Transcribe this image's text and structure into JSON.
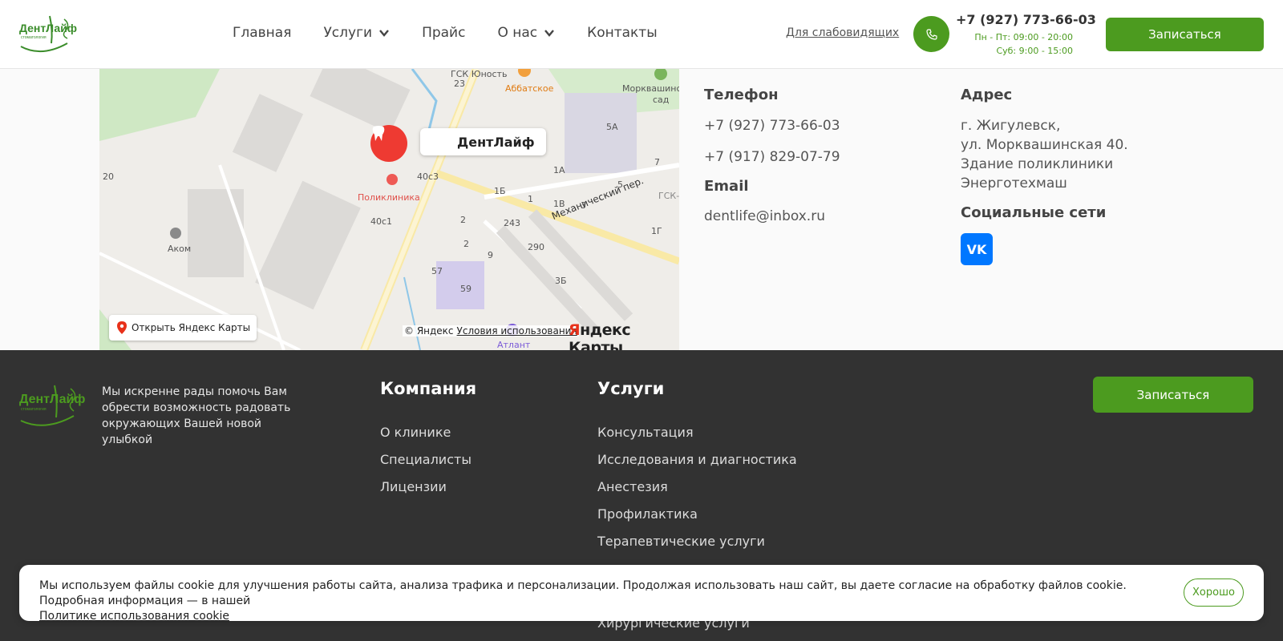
{
  "header": {
    "logo_text": "ДентЛайф",
    "nav": [
      {
        "label": "Главная",
        "dropdown": false
      },
      {
        "label": "Услуги",
        "dropdown": true
      },
      {
        "label": "Прайс",
        "dropdown": false
      },
      {
        "label": "О нас",
        "dropdown": true
      },
      {
        "label": "Контакты",
        "dropdown": false
      }
    ],
    "accessibility_link": "Для слабовидящих",
    "phone": "+7 (927) 773-66-03",
    "hours_weekday": "Пн - Пт: 09:00 - 20:00",
    "hours_saturday": "Суб: 9:00 - 15:00",
    "cta": "Записаться"
  },
  "map": {
    "place_name": "ДентЛайф",
    "open_button": "Открыть Яндекс Карты",
    "copyright": "© Яндекс",
    "terms": "Условия использования",
    "brand_y": "Я",
    "brand_rest": "ндекс Карты",
    "labels": {
      "abbatskoe": "Аббатское",
      "morkvashinsky": "Морквашинский",
      "sad": "сад",
      "poliklinika": "Поликлиника",
      "akom": "Аком",
      "street": "Механический пер.",
      "atlant": "Атлант",
      "gsk": "ГСК-",
      "gsk_yunost": "ГСК Юность",
      "n40c3": "40с3",
      "n40c1": "40с1",
      "n243": "243",
      "n290": "290",
      "n59": "59",
      "n57": "57",
      "n23": "23",
      "n20": "20",
      "n5A": "5А",
      "n1A": "1А",
      "n1B": "1Б",
      "n1V": "1В",
      "n1": "1",
      "n2": "2",
      "n2b": "2",
      "n3": "3",
      "n3B": "3Б",
      "n5": "5",
      "n7": "7",
      "n9": "9",
      "n1G": "1Г"
    }
  },
  "contacts": {
    "phone_heading": "Телефон",
    "phone1": "+7 (927) 773-66-03",
    "phone2": "+7 (917) 829-07-79",
    "email_heading": "Email",
    "email": "dentlife@inbox.ru",
    "address_heading": "Адрес",
    "address_lines": [
      "г. Жигулевск,",
      "ул. Морквашинская 40.",
      "Здание поликлиники",
      "Энерготехмаш"
    ],
    "social_heading": "Социальные сети",
    "vk": "VK"
  },
  "footer": {
    "about": "Мы искренне рады помочь Вам обрести возможность радовать окружающих Вашей новой улыбкой",
    "company_heading": "Компания",
    "company_links": [
      "О клинике",
      "Специалисты",
      "Лицензии"
    ],
    "services_heading": "Услуги",
    "services_links": [
      "Консультация",
      "Исследования и диагностика",
      "Анестезия",
      "Профилактика",
      "Терапевтические услуги",
      "Хирургические услуги"
    ],
    "cta": "Записаться"
  },
  "cookie": {
    "text": "Мы используем файлы cookie для улучшения работы сайта, анализа трафика и персонализации. Продолжая использовать наш сайт, вы даете согласие на обработку файлов cookie. Подробная информация — в нашей",
    "link": "Политике использования cookie",
    "button": "Хорошо"
  },
  "colors": {
    "brand_green": "#4c9b1f",
    "footer_bg": "#323232",
    "pin_red": "#ee3a32",
    "vk_blue": "#0077ff"
  }
}
